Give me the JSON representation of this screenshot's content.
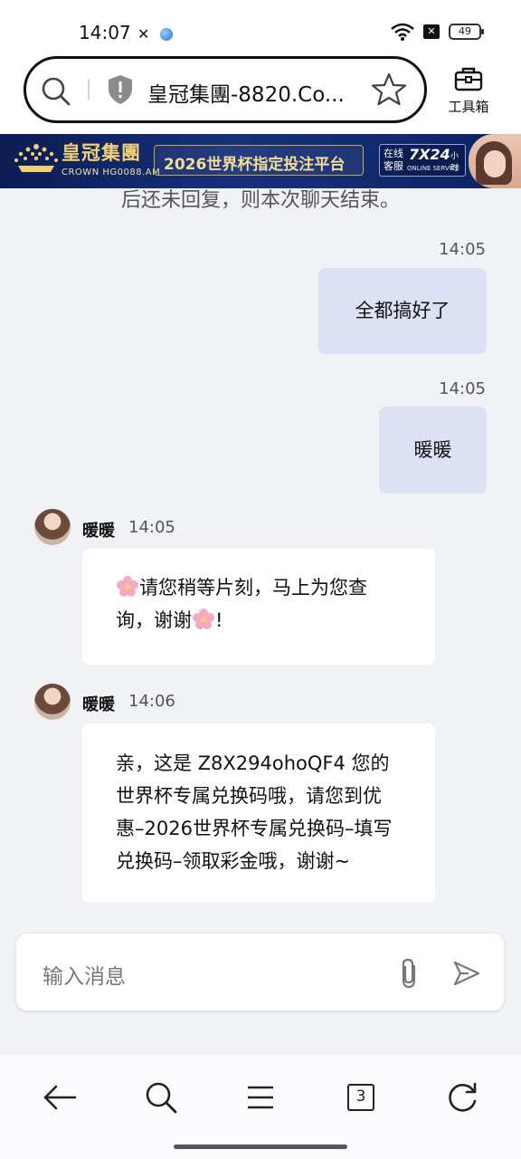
{
  "status_bar": {
    "time": "14:07",
    "battery": "49",
    "icons": [
      "nfc-icon",
      "app-dot-icon",
      "wifi-icon",
      "sim-off-icon",
      "battery-icon"
    ]
  },
  "browser": {
    "url_title": "皇冠集團-8820.Co...",
    "toolbox_label": "工具箱"
  },
  "banner": {
    "brand_cn": "皇冠集團",
    "brand_en": "CROWN HG0088.AM",
    "slogan": "2026世界杯指定投注平台",
    "service_cn": "在线客服",
    "service_hours": "7X24",
    "service_unit": "小时",
    "service_en": "ONLINE SERVICE"
  },
  "chat": {
    "system_note": "后还未回复，则本次聊天结束。",
    "messages": [
      {
        "time": "14:05",
        "text": "全都搞好了"
      },
      {
        "time": "14:05",
        "text": "暖暖"
      },
      {
        "sender": "暖暖",
        "time": "14:05",
        "text_part1": "请您稍等片刻，马上为您查询，谢谢",
        "text_part2": "!"
      },
      {
        "sender": "暖暖",
        "time": "14:06",
        "text": "亲，这是 Z8X294ohoQF4 您的世界杯专属兑换码哦，请您到优惠–2026世界杯专属兑换码–填写兑换码–领取彩金哦，谢谢~"
      }
    ]
  },
  "input": {
    "placeholder": "输入消息"
  },
  "nav": {
    "tab_count": "3"
  },
  "colors": {
    "outgoing_bubble": "#dde1f4",
    "incoming_bubble": "#ffffff",
    "chat_background": "#f1f2f6",
    "banner_blue": "#16317a",
    "banner_gold": "#f3cf74"
  }
}
